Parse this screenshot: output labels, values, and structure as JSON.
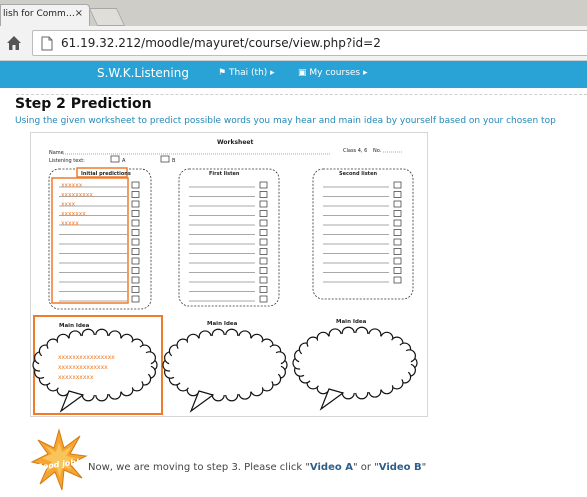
{
  "browser": {
    "tab_title": "lish for Comm…",
    "tab_close": "×",
    "url": "61.19.32.212/moodle/mayuret/course/view.php?id=2"
  },
  "site_nav": {
    "title": "S.W.K.Listening",
    "language": "Thai (th)",
    "my_courses": "My courses"
  },
  "section": {
    "heading": "Step 2 Prediction",
    "instruction": "Using the given worksheet to predict possible words you may hear and main idea by yourself based on your chosen top"
  },
  "worksheet": {
    "title": "Worksheet",
    "name_label": "Name",
    "class_label": "Class 4, 6",
    "no_label": "No.",
    "listening_text_label": "Listening text:",
    "option_a": "A",
    "option_b": "B",
    "col1_title": "Initial predictions",
    "col2_title": "First listen",
    "col3_title": "Second listen",
    "predictions": [
      "xxxxxx",
      "xxxxxxxxx",
      "xxxx",
      "xxxxxxx",
      "xxxxx"
    ],
    "main_idea_label": "Main Idea",
    "main_idea_lines": [
      "xxxxxxxxxxxxxxxx",
      "xxxxxxxxxxxxxx",
      "xxxxxxxxxx"
    ],
    "highlight_color": "#f07b2a"
  },
  "footer": {
    "badge_text": "Good job!",
    "message_prefix": "Now, we are moving to step 3. Please click \"",
    "video_a": "Video A",
    "message_mid": "\" or \"",
    "video_b": "Video B",
    "message_suffix": "\""
  }
}
